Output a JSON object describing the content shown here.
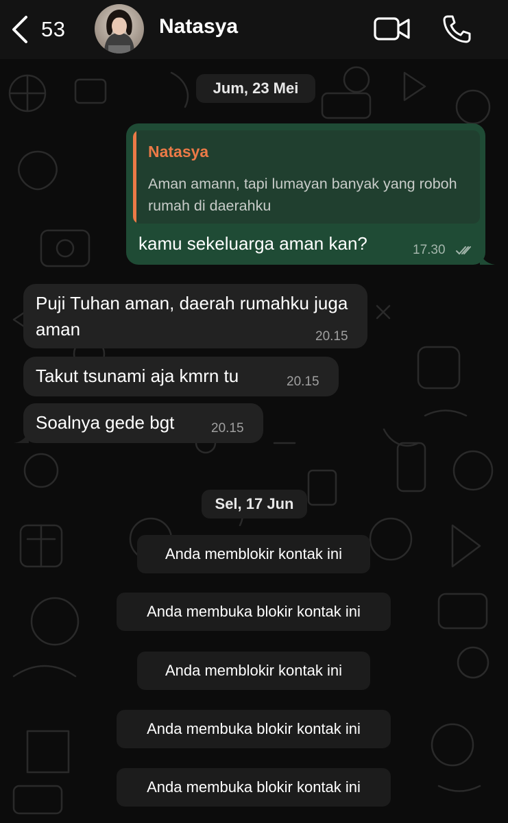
{
  "header": {
    "unread_count": "53",
    "contact_name": "Natasya"
  },
  "chat": {
    "date_1": "Jum, 23 Mei",
    "outgoing": {
      "quote_author": "Natasya",
      "quote_text": "Aman amann, tapi lumayan banyak yang roboh rumah di daerahku",
      "text": "kamu sekeluarga aman kan?",
      "time": "17.30",
      "status": "read"
    },
    "incoming": [
      {
        "text": "Puji Tuhan aman, daerah rumahku juga aman",
        "time": "20.15"
      },
      {
        "text": "Takut tsunami aja kmrn tu",
        "time": "20.15"
      },
      {
        "text": "Soalnya gede bgt",
        "time": "20.15"
      }
    ],
    "date_2": "Sel, 17 Jun",
    "notices": [
      "Anda memblokir kontak ini",
      "Anda membuka blokir kontak ini",
      "Anda memblokir kontak ini",
      "Anda membuka blokir kontak ini",
      "Anda membuka blokir kontak ini"
    ]
  },
  "colors": {
    "background": "#0c0c0c",
    "header": "#131313",
    "outgoing_bubble": "#1f4b35",
    "incoming_bubble": "#222222",
    "quote_accent": "#ec7a47"
  }
}
